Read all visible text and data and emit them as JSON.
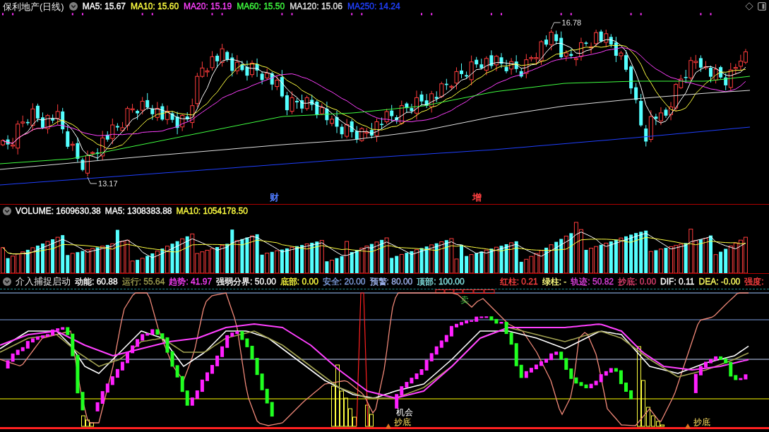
{
  "price_panel": {
    "title": "保利地产(日线)",
    "legend": [
      {
        "label": "MA5: 15.67",
        "color": "#ffffff"
      },
      {
        "label": "MA10: 15.60",
        "color": "#ffff40"
      },
      {
        "label": "MA20: 15.19",
        "color": "#ff40ff"
      },
      {
        "label": "MA60: 15.50",
        "color": "#40ff40"
      },
      {
        "label": "MA120: 15.06",
        "color": "#e0e0e0"
      },
      {
        "label": "MA250: 14.24",
        "color": "#2040ff"
      }
    ],
    "price_labels": [
      {
        "kind": "high",
        "text": "16.78"
      },
      {
        "kind": "low",
        "text": "13.17"
      }
    ],
    "event_labels": [
      {
        "text": "财",
        "color": "#4f7bff"
      },
      {
        "text": "增",
        "color": "#ff4040"
      }
    ]
  },
  "volume_panel": {
    "legend": [
      {
        "label": "VOLUME: 1609630.38",
        "color": "#ffffff"
      },
      {
        "label": "MA5: 1308383.88",
        "color": "#ffffff"
      },
      {
        "label": "MA10: 1054178.50",
        "color": "#ffff40"
      }
    ]
  },
  "indicator_panel": {
    "title": "介入捕捉启动",
    "legend": [
      {
        "label": "动能: 60.88",
        "color": "#ffffff"
      },
      {
        "label": "运行: 55.64",
        "color": "#a0a050"
      },
      {
        "label": "趋势: 41.97",
        "color": "#ff40ff"
      },
      {
        "label": "强弱分界: 50.00",
        "color": "#ffffff"
      },
      {
        "label": "底部: 0.00",
        "color": "#ffff40"
      },
      {
        "label": "安全: 20.00",
        "color": "#7f9fdf"
      },
      {
        "label": "预警: 80.00",
        "color": "#9fb4f0"
      },
      {
        "label": "顶部: 100.00",
        "color": "#80e0e0"
      }
    ],
    "readouts": [
      {
        "label": "红柱: 0.21",
        "color": "#ff4040"
      },
      {
        "label": "绿柱: -",
        "color": "#ffff80"
      },
      {
        "label": "轨迹: 50.82",
        "color": "#e040e0"
      },
      {
        "label": "抄底: 0.00",
        "color": "#e04070"
      },
      {
        "label": "DIF: 0.11",
        "color": "#ffffff"
      },
      {
        "label": "DEA: -0.00",
        "color": "#ffff60"
      },
      {
        "label": "强度:",
        "color": "#ff4040"
      }
    ],
    "signals": [
      {
        "kind": "sell",
        "text": "卖"
      },
      {
        "kind": "chance",
        "text": "机会"
      },
      {
        "kind": "bottom",
        "text": "抄底"
      },
      {
        "kind": "bottom",
        "text": "抄底"
      }
    ]
  }
}
